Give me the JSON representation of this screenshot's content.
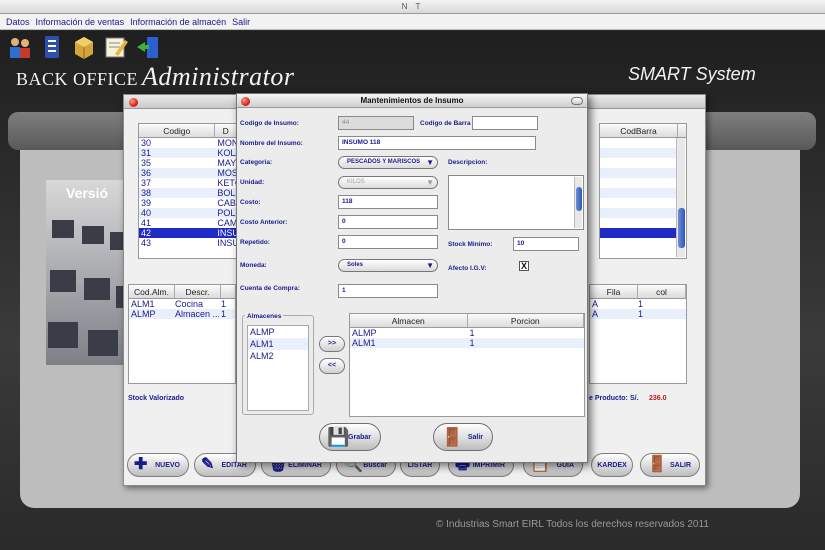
{
  "window": {
    "title": "N T"
  },
  "menu": [
    "Datos",
    "Información de ventas",
    "Información de almacén",
    "Salir"
  ],
  "header": {
    "brand_left": "BACK OFFICE",
    "brand_left_script": "Administrator",
    "brand_right": "SMART System",
    "version_label": "Versió"
  },
  "footer": "© Industrias Smart EIRL Todos los derechos reservados 2011",
  "bg_window": {
    "grid1_headers": [
      "Codigo",
      "D"
    ],
    "grid1_right_header": "CodBarra",
    "grid1_rows": [
      {
        "code": "30",
        "desc": "MON"
      },
      {
        "code": "31",
        "desc": "KOLA"
      },
      {
        "code": "35",
        "desc": "MAYO"
      },
      {
        "code": "36",
        "desc": "MOST"
      },
      {
        "code": "37",
        "desc": "KETC"
      },
      {
        "code": "38",
        "desc": "BOLS"
      },
      {
        "code": "39",
        "desc": "CABR"
      },
      {
        "code": "40",
        "desc": "POLL"
      },
      {
        "code": "41",
        "desc": "CAMO"
      },
      {
        "code": "42",
        "desc": "INSU"
      },
      {
        "code": "43",
        "desc": "INSU"
      }
    ],
    "grid2_headers": [
      "Cod.Alm.",
      "Descr."
    ],
    "grid2_rows": [
      {
        "code": "ALM1",
        "desc": "Cocina",
        "qty": "1"
      },
      {
        "code": "ALMP",
        "desc": "Almacen ...",
        "qty": "1"
      }
    ],
    "grid2_right_headers": [
      "Fila",
      "col"
    ],
    "grid2_right_rows": [
      {
        "a": "A",
        "b": "1"
      },
      {
        "a": "A",
        "b": "1"
      }
    ],
    "stock_valorizado": "Stock Valorizado",
    "total_label": "e Producto:",
    "total_currency": "S/.",
    "total_value": "236.0",
    "buttons": [
      "NUEVO",
      "EDITAR",
      "ELIMINAR",
      "Buscar",
      "LISTAR",
      "IMPRIMIR",
      "GUIA",
      "KARDEX",
      "SALIR"
    ]
  },
  "modal": {
    "title": "Mantenimientos de Insumo",
    "labels": {
      "codigo": "Codigo de Insumo:",
      "barra": "Codigo de Barra",
      "nombre": "Nombre del Insumo:",
      "categoria": "Categoria:",
      "descripcion": "Descripcion:",
      "unidad": "Unidad:",
      "costo": "Costo:",
      "costo_anterior": "Costo Anterior:",
      "repetido": "Repetido:",
      "stock_minimo": "Stock Minimo:",
      "moneda": "Moneda:",
      "igv": "Afecto I.G.V:",
      "cuenta": "Cuenta de Compra:",
      "almacenes": "Almacenes"
    },
    "values": {
      "codigo": "44",
      "barra": "",
      "nombre": "INSUMO 118",
      "categoria": "PESCADOS Y MARISCOS",
      "unidad": "KILOS",
      "costo": "118",
      "costo_anterior": "0",
      "repetido": "0",
      "stock_minimo": "10",
      "moneda": "Soles",
      "cuenta": "1",
      "igv_checked": "X"
    },
    "almacenes_list": [
      "ALMP",
      "ALM1",
      "ALM2"
    ],
    "move_right": ">>",
    "move_left": "<<",
    "assigned_headers": [
      "Almacen",
      "Porcion"
    ],
    "assigned_rows": [
      {
        "almacen": "ALMP",
        "porcion": "1"
      },
      {
        "almacen": "ALM1",
        "porcion": "1"
      }
    ],
    "grabar": "Grabar",
    "salir": "Salir"
  }
}
